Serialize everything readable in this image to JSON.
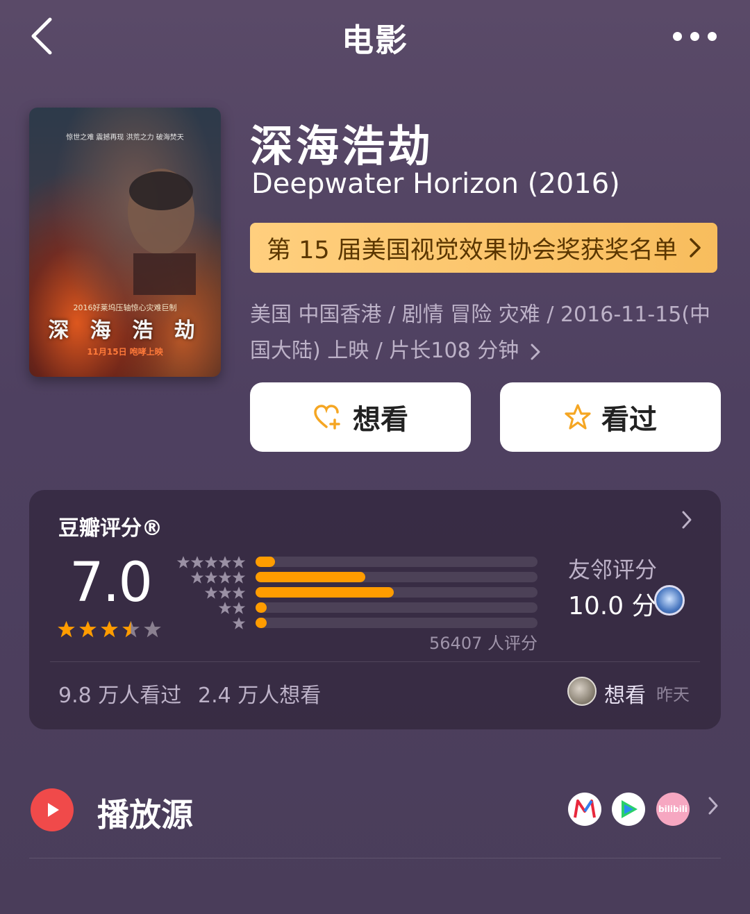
{
  "nav": {
    "title": "电影"
  },
  "poster": {
    "tagline": "惊世之难 震撼再现   洪荒之力 破海焚天",
    "subtitle": "2016好莱坞压轴惊心灾难巨制",
    "title": "深 海 浩 劫",
    "date": "11月15日 咆哮上映"
  },
  "movie": {
    "title_cn": "深海浩劫",
    "title_en": "Deepwater Horizon (2016)",
    "award": "第 15 届美国视觉效果协会奖获奖名单",
    "meta_line1": "美国 中国香港 / 剧情 冒险 灾难 / 2016-11-15(中",
    "meta_line2": "国大陆) 上映 / 片长108 分钟"
  },
  "actions": {
    "want": "想看",
    "seen": "看过"
  },
  "rating": {
    "header": "豆瓣评分®",
    "score": "7.0",
    "stars": 3.5,
    "distribution_percent": [
      7,
      39,
      49,
      4,
      4
    ],
    "count": "56407 人评分",
    "friend_label": "友邻评分",
    "friend_score": "10.0 分"
  },
  "stats": {
    "seen": "9.8 万人看过",
    "want": "2.4 万人想看",
    "user_action": "想看",
    "user_time": "昨天"
  },
  "play": {
    "label": "播放源",
    "sources": [
      "youku-icon",
      "tencent-video-icon",
      "bilibili-icon"
    ],
    "bilibili_text": "bilibili"
  },
  "colors": {
    "accent": "#ff9c00",
    "award_bg": "#ffcf7e",
    "play_red": "#f04a4a"
  }
}
